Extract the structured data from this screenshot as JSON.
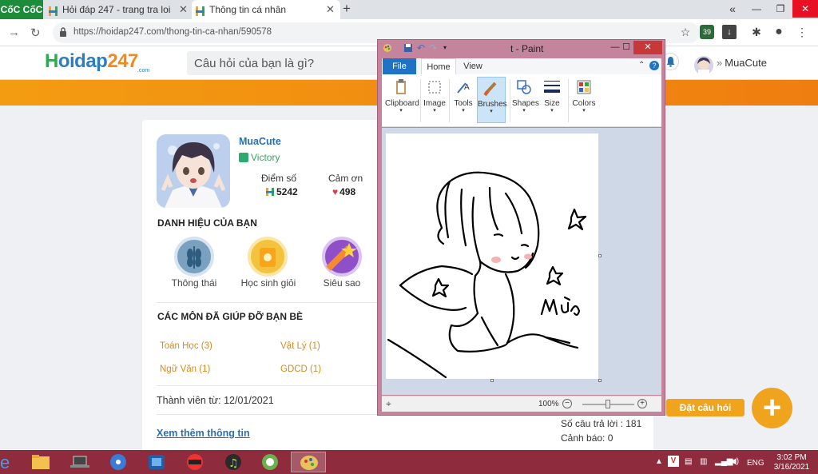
{
  "browser": {
    "brand": "CốC CốC",
    "tabs": [
      {
        "title": "Hỏi đáp 247 - trang tra loi",
        "close": "✕"
      },
      {
        "title": "Thông tin cá nhân",
        "close": "✕"
      }
    ],
    "new_tab": "+",
    "url": "https://hoidap247.com/thong-tin-ca-nhan/590578",
    "extension_badge": "39"
  },
  "site": {
    "logo": {
      "part1": "H",
      "part2": "oidap",
      "part3": "247",
      "suffix": ".com"
    },
    "search_placeholder": "Câu hỏi của bạn là gì?",
    "user_name": "MuaCute",
    "user_chevron": "»"
  },
  "profile": {
    "name": "MuaCute",
    "rank": "Victory",
    "points_label": "Điểm số",
    "points": "5242",
    "thanks_label": "Cảm ơn",
    "thanks": "498",
    "titles_heading": "DANH HIỆU CỦA BẠN",
    "badges": [
      {
        "label": "Thông thái",
        "color": "#7aa1c0"
      },
      {
        "label": "Học sinh giỏi",
        "color": "#f3c33d"
      },
      {
        "label": "Siêu sao",
        "color": "#8e4fc8"
      }
    ],
    "subjects_heading": "CÁC MÔN ĐÃ GIÚP ĐỠ BẠN BÈ",
    "subjects": [
      "Toán Học (3)",
      "Vật Lý (1)",
      "Ngữ Văn (1)",
      "GDCD (1)"
    ],
    "member_since": "Thành viên từ: 12/01/2021",
    "more_info": "Xem thêm thông tin",
    "answers": "Số câu trả lời : 181",
    "warnings": "Cảnh báo: 0"
  },
  "ask": {
    "label": "Đặt câu hỏi",
    "plus": "+"
  },
  "paint": {
    "title": "t - Paint",
    "tabs": {
      "file": "File",
      "home": "Home",
      "view": "View"
    },
    "ribbon": [
      "Clipboard",
      "Image",
      "Tools",
      "Brushes",
      "Shapes",
      "Size",
      "Colors"
    ],
    "selected_tool": "Brushes",
    "drawing_text": "Mưa",
    "zoom": "100%",
    "zoom_level": 100
  },
  "taskbar": {
    "lang": "ENG",
    "time": "3:02 PM",
    "date": "3/16/2021"
  }
}
